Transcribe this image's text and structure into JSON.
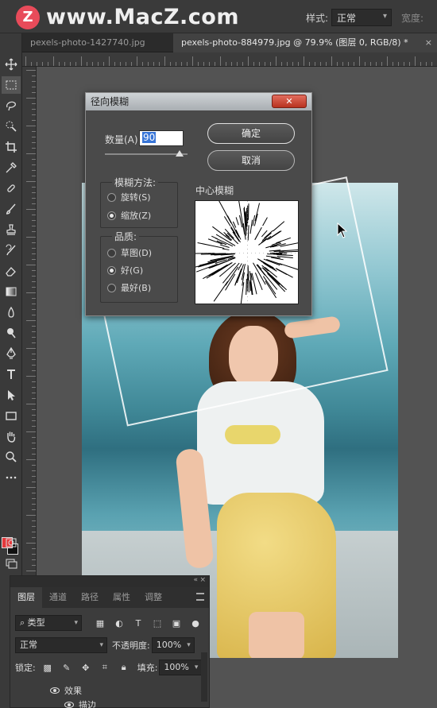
{
  "watermark": {
    "logo_letter": "Z",
    "text": "www.MacZ.com"
  },
  "options_bar": {
    "style_label": "样式:",
    "style_value": "正常",
    "width_label": "宽度:"
  },
  "tabs": [
    {
      "label": "pexels-photo-1427740.jpg"
    },
    {
      "label": "pexels-photo-884979.jpg @ 79.9% (图层 0, RGB/8) *",
      "close": "×"
    }
  ],
  "dialog": {
    "title": "径向模糊",
    "amount_label": "数量(A):",
    "amount_value": "90",
    "amount_fraction": 0.9,
    "ok_label": "确定",
    "cancel_label": "取消",
    "blur_method": {
      "title": "模糊方法:",
      "options": [
        {
          "label": "旋转(S)",
          "selected": false
        },
        {
          "label": "缩放(Z)",
          "selected": true
        }
      ]
    },
    "quality": {
      "title": "品质:",
      "options": [
        {
          "label": "草图(D)",
          "selected": false
        },
        {
          "label": "好(G)",
          "selected": true
        },
        {
          "label": "最好(B)",
          "selected": false
        }
      ]
    },
    "center_label": "中心模糊"
  },
  "layers_panel": {
    "tabs": [
      "图层",
      "通道",
      "路径",
      "属性",
      "调整"
    ],
    "active_tab": "图层",
    "filter_label": "类型",
    "blend_mode": "正常",
    "opacity_label": "不透明度:",
    "opacity_value": "100%",
    "lock_label": "锁定:",
    "fill_label": "填充:",
    "fill_value": "100%",
    "effects_label": "效果",
    "stroke_label": "描边"
  },
  "colors": {
    "foreground": "#e5383b",
    "background": "#111111",
    "accent": "#3875d7"
  }
}
